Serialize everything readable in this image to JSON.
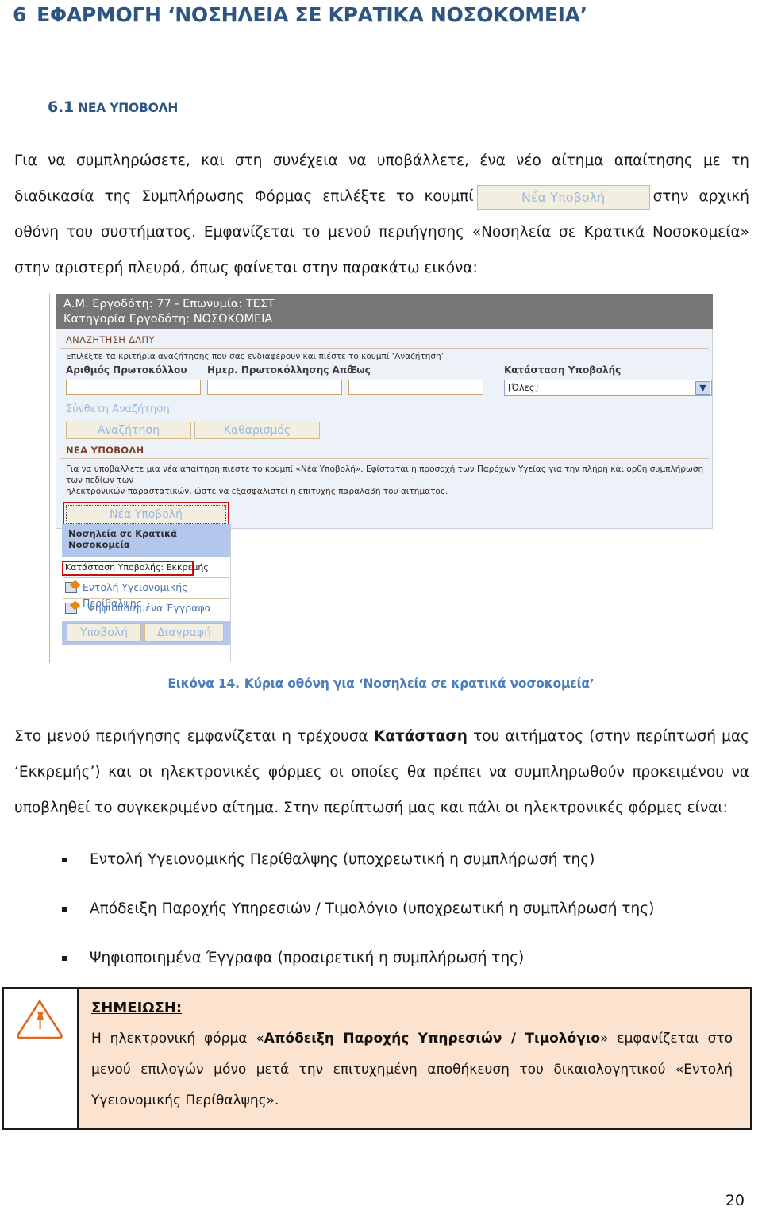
{
  "heading1": {
    "number": "6",
    "text": "ΕΦΑΡΜΟΓΗ ‘ΝΟΣΗΛΕΙΑ ΣΕ ΚΡΑΤΙΚΑ ΝΟΣΟΚΟΜΕΙΑ’"
  },
  "heading2": {
    "number": "6.1",
    "text": "ΝΕΑ ΥΠΟΒΟΛΗ"
  },
  "paragraphs": {
    "intro_part1": "Για να συμπληρώσετε, και στη συνέχεια να υποβάλλετε, ένα νέο αίτημα απαίτησης με τη διαδικασία της Συμπλήρωσης Φόρμας επιλέξτε το κουμπί",
    "intro_inline_button": "Νέα Υποβολή",
    "intro_part2": "στην αρχική οθόνη του συστήματος. Εμφανίζεται το μενού περιήγησης «Νοσηλεία σε Κρατικά Νοσοκομεία» στην αριστερή πλευρά, όπως φαίνεται στην παρακάτω εικόνα:",
    "after_part1": "Στο μενού περιήγησης εμφανίζεται η τρέχουσα ",
    "after_bold": "Κατάσταση",
    "after_part2": " του αιτήματος (στην περίπτωσή μας ‘Εκκρεμής’) και οι ηλεκτρονικές φόρμες οι οποίες θα πρέπει να συμπληρωθούν προκειμένου να υποβληθεί το συγκεκριμένο αίτημα. Στην περίπτωσή μας και πάλι οι ηλεκτρονικές φόρμες είναι:"
  },
  "figure": {
    "caption_number": "Εικόνα 14.",
    "caption_text": "Κύρια οθόνη για ‘Νοσηλεία σε κρατικά νοσοκομεία’"
  },
  "app_screenshot": {
    "header": {
      "line1": "Α.Μ. Εργοδότη: 77 - Επωνυμία: ΤΕΣΤ",
      "line2": "Κατηγορία Εργοδότη: ΝΟΣΟΚΟΜΕΙΑ"
    },
    "search_section": {
      "title": "ΑΝΑΖΗΤΗΣΗ ΔΑΠΥ",
      "hint": "Επιλέξτε τα κριτήρια αναζήτησης που σας ενδιαφέρουν και πιέστε το κουμπί ‘Αναζήτηση’",
      "fields": [
        {
          "label": "Αριθμός Πρωτοκόλλου",
          "value": ""
        },
        {
          "label": "Ημερ. Πρωτοκόλλησης Από",
          "value": ""
        },
        {
          "label": "Έως",
          "value": ""
        }
      ],
      "status_field": {
        "label": "Κατάσταση Υποβολής",
        "value": "[Όλες]",
        "chevron": "chevron-down-icon"
      },
      "advanced_link": "Σύνθετη Αναζήτηση",
      "search_button": "Αναζήτηση",
      "clear_button": "Καθαρισμός"
    },
    "new_submission_section": {
      "title": "ΝΕΑ ΥΠΟΒΟΛΗ",
      "hint_line1": "Για να υποβάλλετε μια νέα απαίτηση πιέστε το κουμπί «Νέα Υποβολή». Εφίσταται η προσοχή των Παρόχων Υγείας για την πλήρη και ορθή συμπλήρωση των πεδίων των",
      "hint_line2": "ηλεκτρονικών παραστατικών, ώστε να εξασφαλιστεί η επιτυχής παραλαβή του αιτήματος.",
      "button": "Νέα Υποβολή"
    },
    "nav_menu": {
      "title": "Νοσηλεία σε Κρατικά Νοσοκομεία",
      "status": "Κατάσταση Υποβολής: Εκκρεμής",
      "items": [
        {
          "label": "Εντολή Υγειονομικής Περίθαλψης",
          "icon": "document-edit-icon"
        },
        {
          "label": "Ψηφιοποιημένα Έγγραφα",
          "icon": "document-edit-icon"
        }
      ],
      "submit_button": "Υποβολή",
      "delete_button": "Διαγραφή"
    },
    "colors": {
      "header_gray": "#767676",
      "body_blue": "#EDF1F8",
      "button_cream": "#F2EFE1",
      "button_text_blue": "#9BB8DE",
      "highlight_red": "#C11212",
      "menu_blue": "#B3C7EC",
      "section_title_brown": "#7B3F20"
    }
  },
  "bullets": [
    "Εντολή Υγειονομικής Περίθαλψης (υποχρεωτική η συμπλήρωσή της)",
    "Απόδειξη Παροχής Υπηρεσιών / Τιμολόγιο (υποχρεωτική η συμπλήρωσή της)",
    "Ψηφιοποιημένα Έγγραφα (προαιρετική η συμπλήρωσή της)"
  ],
  "note": {
    "icon": "warning-pushpin-icon",
    "title": "ΣΗΜΕΙΩΣΗ:",
    "part1": "Η ηλεκτρονική φόρμα «",
    "bold": "Απόδειξη Παροχής Υπηρεσιών / Τιμολόγιο",
    "part2": "» εμφανίζεται στο μενού επιλογών μόνο μετά την επιτυχημένη αποθήκευση του δικαιολογητικού «Εντολή Υγειονομικής Περίθαλψης».",
    "background": "#FBE3CF",
    "icon_color": "#E2671C"
  },
  "page_number": "20"
}
